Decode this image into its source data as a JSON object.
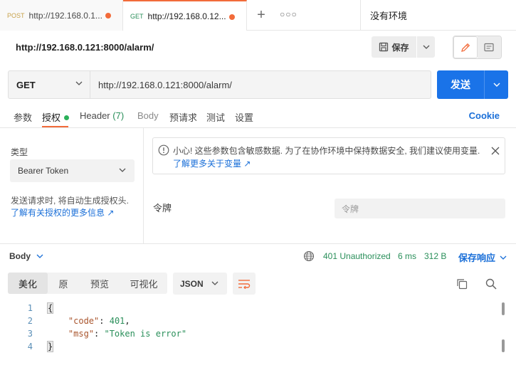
{
  "tabs": [
    {
      "method": "POST",
      "title": "http://192.168.0.1..."
    },
    {
      "method": "GET",
      "title": "http://192.168.0.12..."
    }
  ],
  "environment": "没有环境",
  "request_title": "http://192.168.0.121:8000/alarm/",
  "toolbar": {
    "save_label": "保存"
  },
  "request": {
    "method": "GET",
    "url": "http://192.168.0.121:8000/alarm/",
    "send_label": "发送"
  },
  "subtabs": {
    "params": "参数",
    "auth": "授权",
    "headers": "Header",
    "headers_count": "(7)",
    "body": "Body",
    "prerequest": "预请求",
    "tests": "测试",
    "settings": "设置",
    "cookie": "Cookie"
  },
  "auth": {
    "type_label": "类型",
    "type_value": "Bearer Token",
    "help_text": "发送请求时, 将自动生成授权头.",
    "help_link": "了解有关授权的更多信息 ↗",
    "warning_text": "小心! 这些参数包含敏感数据. 为了在协作环境中保持数据安全, 我们建议使用变量.",
    "warning_link": "了解更多关于变量 ↗",
    "token_label": "令牌",
    "token_placeholder": "令牌"
  },
  "response": {
    "body_label": "Body",
    "status": "401 Unauthorized",
    "time": "6 ms",
    "size": "312 B",
    "save_label": "保存响应",
    "view_tabs": [
      "美化",
      "原",
      "预览",
      "可视化"
    ],
    "format": "JSON",
    "code_lines": [
      {
        "n": "1",
        "text": "{"
      },
      {
        "n": "2",
        "key": "\"code\"",
        "value": "401"
      },
      {
        "n": "3",
        "key": "\"msg\"",
        "value": "\"Token is error\""
      },
      {
        "n": "4",
        "text": "}"
      }
    ]
  },
  "colors": {
    "accent": "#f26b3a",
    "primary": "#1a73e8",
    "success": "#2a8f5a",
    "link": "#1a6fd8"
  }
}
